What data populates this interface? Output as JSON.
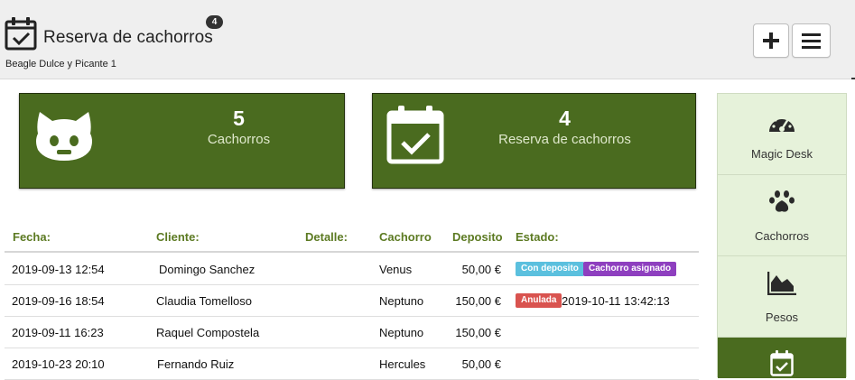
{
  "header": {
    "title": "Reserva de cachorros",
    "count_badge": "4",
    "subtitle": "Beagle Dulce y Picante 1",
    "title_icon": "calendar-check-icon",
    "add_button_icon": "plus-icon",
    "menu_button_icon": "hamburger-menu-icon"
  },
  "stats": [
    {
      "value": "5",
      "label": "Cachorros",
      "icon": "github-cat-icon"
    },
    {
      "value": "4",
      "label": "Reserva de cachorros",
      "icon": "calendar-check-icon"
    }
  ],
  "table": {
    "columns": [
      "Fecha:",
      "Cliente:",
      "Detalle:",
      "Cachorro",
      "Deposito",
      "Estado:"
    ],
    "rows": [
      {
        "fecha": "2019-09-13 12:54",
        "cliente": "Domingo Sanchez",
        "detalle": "",
        "cachorro": "Venus",
        "deposito": "50,00 €",
        "estado_tags": [
          "Con deposito",
          "Cachorro asignado"
        ],
        "estado_text": ""
      },
      {
        "fecha": "2019-09-16 18:54",
        "cliente": "Claudia Tomelloso",
        "detalle": "",
        "cachorro": "Neptuno",
        "deposito": "150,00 €",
        "estado_tags": [
          "Anulada"
        ],
        "estado_text": "2019-10-11 13:42:13"
      },
      {
        "fecha": "2019-09-11 16:23",
        "cliente": "Raquel Compostela",
        "detalle": "",
        "cachorro": "Neptuno",
        "deposito": "150,00 €",
        "estado_tags": [],
        "estado_text": ""
      },
      {
        "fecha": "2019-10-23 20:10",
        "cliente": "Fernando Ruiz",
        "detalle": "",
        "cachorro": "Hercules",
        "deposito": "50,00 €",
        "estado_tags": [],
        "estado_text": ""
      }
    ]
  },
  "sidebar": {
    "items": [
      {
        "label": "Magic Desk",
        "icon": "dashboard-gauge-icon",
        "active": false
      },
      {
        "label": "Cachorros",
        "icon": "paw-icon",
        "active": false
      },
      {
        "label": "Pesos",
        "icon": "area-chart-icon",
        "active": false
      },
      {
        "label": "",
        "icon": "calendar-check-icon",
        "active": true
      }
    ]
  },
  "colors": {
    "card_green": "#4a6b1f",
    "header_green": "#5c7a22",
    "sidebar_bg": "#e6f2da",
    "tag_blue": "#5bc0de",
    "tag_purple": "#8e3fbf",
    "tag_red": "#d9534f"
  }
}
